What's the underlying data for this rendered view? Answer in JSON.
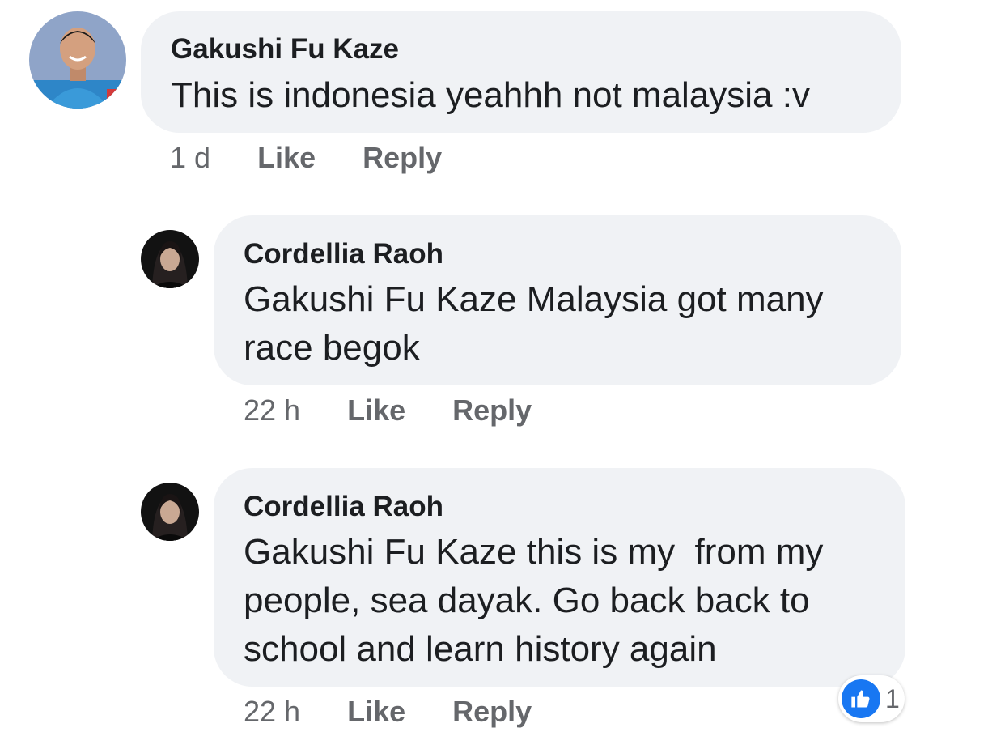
{
  "comments": [
    {
      "author": "Gakushi Fu Kaze",
      "text": "This is indonesia yeahhh not malaysia :v",
      "time": "1 d",
      "like_label": "Like",
      "reply_label": "Reply"
    },
    {
      "author": "Cordellia Raoh",
      "text_line1": "Gakushi Fu Kaze Malaysia got many",
      "text_line2": "race begok",
      "time": "22 h",
      "like_label": "Like",
      "reply_label": "Reply"
    },
    {
      "author": "Cordellia Raoh",
      "text_line1": "Gakushi Fu Kaze this is my  from my",
      "text_line2": "people, sea dayak. Go back back to",
      "text_line3": "school and learn history again",
      "time": "22 h",
      "like_label": "Like",
      "reply_label": "Reply",
      "reaction": {
        "icon": "thumbs-up-icon",
        "count": "1",
        "color": "#1877f2"
      }
    }
  ],
  "colors": {
    "bubble": "#f0f2f5",
    "meta_text": "#65676b",
    "primary_text": "#1c1e21"
  }
}
